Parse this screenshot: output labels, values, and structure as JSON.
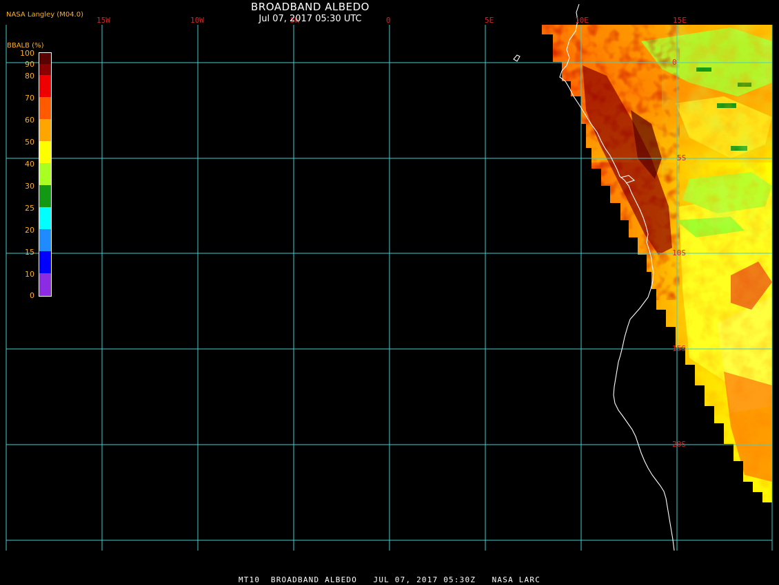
{
  "header": {
    "title": "BROADBAND ALBEDO",
    "subtitle": "Jul 07, 2017 05:30 UTC",
    "source": "NASA Langley (M04.0)"
  },
  "colorbar": {
    "label": "BBALB (%)",
    "ticks": [
      "100",
      "90",
      "80",
      "70",
      "60",
      "50",
      "40",
      "30",
      "25",
      "20",
      "15",
      "10",
      "0"
    ],
    "colors": [
      "#5a0000",
      "#8b0000",
      "#ee0000",
      "#ff5a00",
      "#ffa500",
      "#ffff00",
      "#aaff22",
      "#139813",
      "#00ffff",
      "#1e8cff",
      "#0000ff",
      "#8b2be2"
    ]
  },
  "map": {
    "lon_labels": [
      "15W",
      "10W",
      "5W",
      "0",
      "5E",
      "10E",
      "15E"
    ],
    "lat_labels": [
      "0",
      "5S",
      "10S",
      "15S",
      "20S"
    ]
  },
  "footer": "MT10  BROADBAND ALBEDO   JUL 07, 2017 05:30Z   NASA LARC",
  "colors": {
    "grid": "#40d0d0",
    "coast": "#ffffff",
    "label": "#e02020",
    "accent": "#ffb020"
  }
}
